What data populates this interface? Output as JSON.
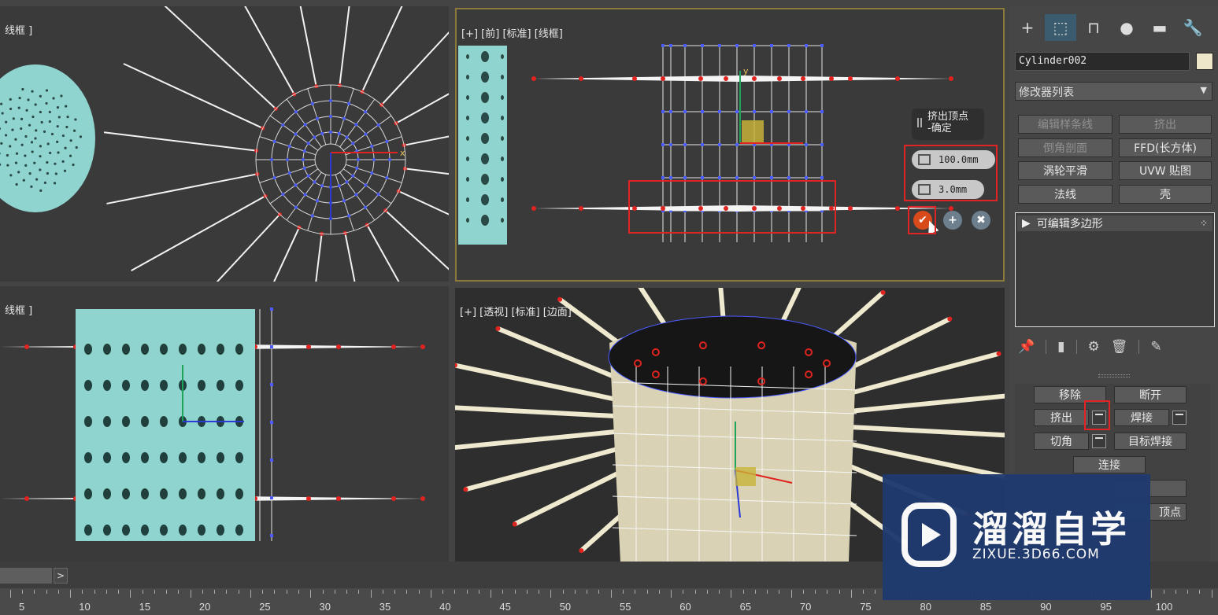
{
  "viewports": {
    "top_left_label": "线框 ]",
    "top_right_label": "[+] [前] [标准] [线框]",
    "bottom_left_label": "线框 ]",
    "bottom_right_label": "[+] [透视] [标准] [边面]",
    "axis_x": "x",
    "axis_y": "y"
  },
  "extrude_caddy": {
    "title_line1": "挤出顶点",
    "title_line2": "-确定",
    "height_value": "100.0mm",
    "width_value": "3.0mm"
  },
  "command_panel": {
    "tabs": [
      "create",
      "modify",
      "hierarchy",
      "motion",
      "display",
      "utilities"
    ],
    "object_name": "Cylinder002",
    "object_color": "#ede6c8",
    "modifier_list": "修改器列表",
    "buttons": {
      "edit_spline": "编辑样条线",
      "extrude": "挤出",
      "chamfer_profile": "倒角剖面",
      "ffd_box": "FFD(长方体)",
      "turbosmooth": "涡轮平滑",
      "uvw_map": "UVW 贴图",
      "normal": "法线",
      "shell": "壳"
    },
    "stack_item": "可编辑多边形",
    "vertex_rollout": {
      "remove": "移除",
      "break": "断开",
      "extrude": "挤出",
      "weld": "焊接",
      "chamfer": "切角",
      "target_weld": "目标焊接",
      "connect": "连接",
      "vertex_partial": "顶点"
    }
  },
  "timeline": {
    "next_arrow": ">",
    "ticks": [
      "5",
      "10",
      "15",
      "20",
      "25",
      "30",
      "35",
      "40",
      "45",
      "50",
      "55",
      "60",
      "65",
      "70",
      "75",
      "80",
      "85",
      "90",
      "95",
      "100"
    ]
  },
  "watermark": {
    "brand": "溜溜自学",
    "url": "ZIXUE.3D66.COM"
  },
  "colors": {
    "mesh_cyan": "#8fd4cf",
    "vertex_red": "#e0231f",
    "vertex_blue": "#4b5cff",
    "highlight_red": "#e02424",
    "active_viewport_border": "#8c7a3c",
    "cylinder_fill": "#d9d2b4"
  }
}
